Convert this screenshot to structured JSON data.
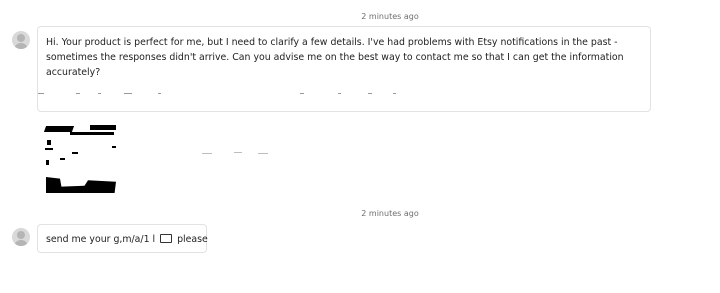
{
  "thread": {
    "messages": [
      {
        "timestamp": "2 minutes ago",
        "text": "Hi. Your product is perfect for me, but I need to clarify a few details. I've had problems with Etsy notifications in the past - sometimes the responses didn't arrive. Can you advise me on the best way to contact me so that I can get the information accurately?"
      },
      {
        "timestamp": "2 minutes ago",
        "text_before_icon": "send me your g,m/a/1 l",
        "icon": "envelope-icon",
        "text_after_icon": "please"
      }
    ]
  },
  "colors": {
    "background": "#ffffff",
    "bubble_border": "#e2e2e2",
    "timestamp": "#6e6e6e",
    "avatar": "#d9d9d9"
  }
}
